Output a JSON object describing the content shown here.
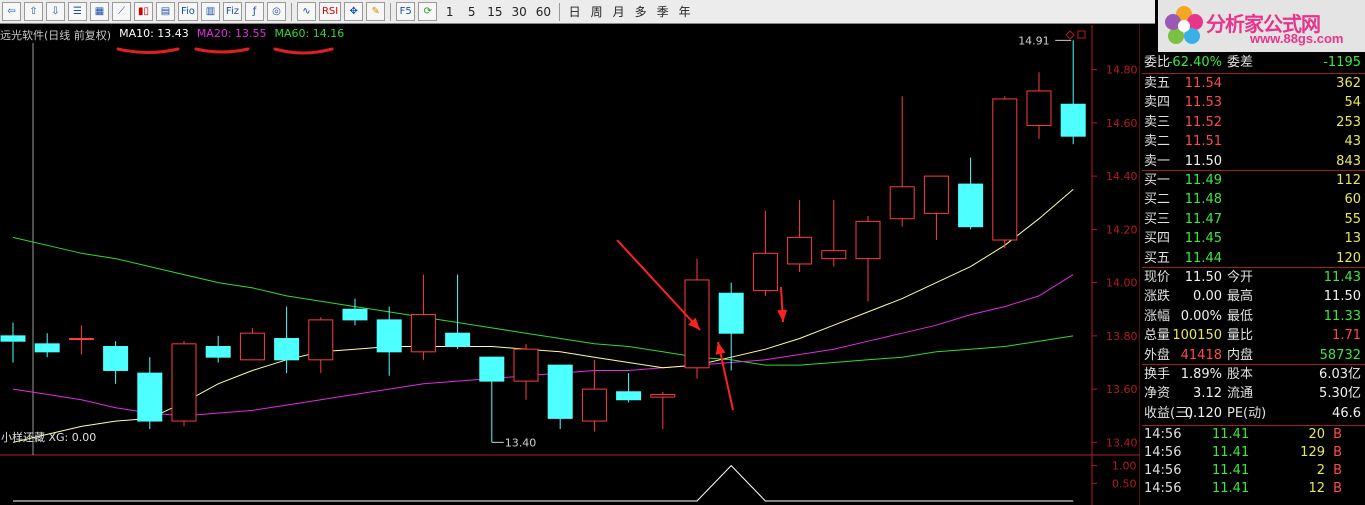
{
  "toolbar": {
    "icons": [
      "back-arrow-icon",
      "up-arrow-icon",
      "down-arrow-icon",
      "list-icon",
      "grid-icon",
      "line-chart-icon",
      "candle-chart-icon",
      "f10-icon",
      "fio-icon",
      "doc-icon",
      "fiz-icon",
      "flow-icon",
      "circle-icon"
    ],
    "indicator_buttons": [
      "RSI"
    ],
    "tool_icons": [
      "wave-icon",
      "move-icon",
      "pen-icon"
    ],
    "f5_label": "F5",
    "refresh_icon": "refresh-icon",
    "minute_periods": [
      "1",
      "5",
      "15",
      "30",
      "60"
    ],
    "periods": [
      "日",
      "周",
      "月",
      "多",
      "季",
      "年"
    ]
  },
  "logo": {
    "text": "分析家公式网",
    "url": "www.88gs.com",
    "icon": "flower-logo-icon"
  },
  "chart": {
    "title": "远光软件(日线 前复权)",
    "ma10_label": "MA10: 13.43",
    "ma20_label": "MA20: 13.55",
    "ma60_label": "MA60: 14.16",
    "high_marker": "14.91",
    "low_marker": "13.40",
    "indicator_label": "小样还藏 XG: 0.00",
    "colors": {
      "up": "#ff3c3c",
      "down": "#4dffff",
      "ma10": "#ffffa0",
      "ma20": "#e22be2",
      "ma60": "#32d832",
      "axis": "#b01e1e",
      "annotation": "#ff2020"
    }
  },
  "chart_data": {
    "type": "candlestick",
    "ylim": [
      13.36,
      14.9
    ],
    "y_ticks": [
      "14.80",
      "14.60",
      "14.40",
      "14.20",
      "14.00",
      "13.80",
      "13.60",
      "13.40"
    ],
    "candles": [
      {
        "o": 13.8,
        "h": 13.85,
        "l": 13.7,
        "c": 13.78
      },
      {
        "o": 13.77,
        "h": 13.81,
        "l": 13.72,
        "c": 13.74
      },
      {
        "o": 13.79,
        "h": 13.84,
        "l": 13.73,
        "c": 13.79
      },
      {
        "o": 13.76,
        "h": 13.78,
        "l": 13.62,
        "c": 13.67
      },
      {
        "o": 13.66,
        "h": 13.72,
        "l": 13.45,
        "c": 13.48
      },
      {
        "o": 13.48,
        "h": 13.78,
        "l": 13.46,
        "c": 13.77
      },
      {
        "o": 13.76,
        "h": 13.8,
        "l": 13.7,
        "c": 13.72
      },
      {
        "o": 13.71,
        "h": 13.83,
        "l": 13.71,
        "c": 13.81
      },
      {
        "o": 13.79,
        "h": 13.91,
        "l": 13.66,
        "c": 13.71
      },
      {
        "o": 13.71,
        "h": 13.87,
        "l": 13.66,
        "c": 13.86
      },
      {
        "o": 13.9,
        "h": 13.94,
        "l": 13.84,
        "c": 13.86
      },
      {
        "o": 13.86,
        "h": 13.91,
        "l": 13.65,
        "c": 13.74
      },
      {
        "o": 13.74,
        "h": 14.03,
        "l": 13.71,
        "c": 13.88
      },
      {
        "o": 13.81,
        "h": 14.03,
        "l": 13.75,
        "c": 13.76
      },
      {
        "o": 13.72,
        "h": 13.72,
        "l": 13.4,
        "c": 13.63
      },
      {
        "o": 13.63,
        "h": 13.77,
        "l": 13.56,
        "c": 13.75
      },
      {
        "o": 13.69,
        "h": 13.69,
        "l": 13.45,
        "c": 13.49
      },
      {
        "o": 13.48,
        "h": 13.71,
        "l": 13.44,
        "c": 13.6
      },
      {
        "o": 13.59,
        "h": 13.66,
        "l": 13.55,
        "c": 13.56
      },
      {
        "o": 13.57,
        "h": 13.59,
        "l": 13.45,
        "c": 13.58
      },
      {
        "o": 13.68,
        "h": 14.09,
        "l": 13.64,
        "c": 14.01
      },
      {
        "o": 13.96,
        "h": 14.0,
        "l": 13.67,
        "c": 13.81
      },
      {
        "o": 13.97,
        "h": 14.27,
        "l": 13.95,
        "c": 14.11
      },
      {
        "o": 14.07,
        "h": 14.31,
        "l": 14.04,
        "c": 14.17
      },
      {
        "o": 14.09,
        "h": 14.31,
        "l": 14.06,
        "c": 14.12
      },
      {
        "o": 14.09,
        "h": 14.25,
        "l": 13.93,
        "c": 14.23
      },
      {
        "o": 14.24,
        "h": 14.7,
        "l": 14.21,
        "c": 14.36
      },
      {
        "o": 14.26,
        "h": 14.4,
        "l": 14.16,
        "c": 14.4
      },
      {
        "o": 14.37,
        "h": 14.47,
        "l": 14.2,
        "c": 14.21
      },
      {
        "o": 14.16,
        "h": 14.7,
        "l": 14.13,
        "c": 14.69
      },
      {
        "o": 14.59,
        "h": 14.79,
        "l": 14.54,
        "c": 14.72
      },
      {
        "o": 14.67,
        "h": 14.91,
        "l": 14.52,
        "c": 14.55
      }
    ],
    "ma10": [
      13.4,
      13.43,
      13.46,
      13.48,
      13.49,
      13.55,
      13.62,
      13.67,
      13.71,
      13.74,
      13.75,
      13.76,
      13.76,
      13.76,
      13.76,
      13.75,
      13.74,
      13.72,
      13.7,
      13.68,
      13.69,
      13.72,
      13.75,
      13.79,
      13.84,
      13.89,
      13.94,
      14.0,
      14.06,
      14.14,
      14.24,
      14.35
    ],
    "ma20": [
      13.6,
      13.58,
      13.56,
      13.53,
      13.51,
      13.5,
      13.51,
      13.52,
      13.54,
      13.56,
      13.58,
      13.6,
      13.62,
      13.63,
      13.64,
      13.65,
      13.66,
      13.67,
      13.67,
      13.68,
      13.69,
      13.7,
      13.71,
      13.73,
      13.75,
      13.78,
      13.81,
      13.84,
      13.88,
      13.91,
      13.95,
      14.03
    ],
    "ma60": [
      14.17,
      14.14,
      14.11,
      14.09,
      14.06,
      14.03,
      14.0,
      13.98,
      13.95,
      13.93,
      13.91,
      13.89,
      13.87,
      13.85,
      13.83,
      13.81,
      13.79,
      13.77,
      13.76,
      13.74,
      13.72,
      13.71,
      13.69,
      13.69,
      13.7,
      13.71,
      13.72,
      13.74,
      13.75,
      13.76,
      13.78,
      13.8
    ],
    "ind_ylim": [
      0,
      1.3
    ],
    "ind_ticks": [
      "1.00",
      "0.50"
    ],
    "ind_values": [
      0,
      0,
      0,
      0,
      0,
      0,
      0,
      0,
      0,
      0,
      0,
      0,
      0,
      0,
      0,
      0,
      0,
      0,
      0,
      0,
      0,
      1,
      0,
      0,
      0,
      0,
      0,
      0,
      0,
      0,
      0,
      0
    ]
  },
  "quote": {
    "wb_label": "委比",
    "wb_value": "-62.40%",
    "wc_label": "委差",
    "wc_value": "-1195",
    "asks": [
      {
        "label": "卖五",
        "price": "11.54",
        "vol": "362"
      },
      {
        "label": "卖四",
        "price": "11.53",
        "vol": "54"
      },
      {
        "label": "卖三",
        "price": "11.52",
        "vol": "253"
      },
      {
        "label": "卖二",
        "price": "11.51",
        "vol": "43"
      },
      {
        "label": "卖一",
        "price": "11.50",
        "vol": "843"
      }
    ],
    "bids": [
      {
        "label": "买一",
        "price": "11.49",
        "vol": "112"
      },
      {
        "label": "买二",
        "price": "11.48",
        "vol": "60"
      },
      {
        "label": "买三",
        "price": "11.47",
        "vol": "55"
      },
      {
        "label": "买四",
        "price": "11.45",
        "vol": "13"
      },
      {
        "label": "买五",
        "price": "11.44",
        "vol": "120"
      }
    ],
    "stats": [
      {
        "l1": "现价",
        "v1": "11.50",
        "c1": "white",
        "l2": "今开",
        "v2": "11.43",
        "c2": "green"
      },
      {
        "l1": "涨跌",
        "v1": "0.00",
        "c1": "white",
        "l2": "最高",
        "v2": "11.50",
        "c2": "white"
      },
      {
        "l1": "涨幅",
        "v1": "0.00%",
        "c1": "white",
        "l2": "最低",
        "v2": "11.33",
        "c2": "green"
      },
      {
        "l1": "总量",
        "v1": "100150",
        "c1": "yellow",
        "l2": "量比",
        "v2": "1.71",
        "c2": "red"
      },
      {
        "l1": "外盘",
        "v1": "41418",
        "c1": "red",
        "l2": "内盘",
        "v2": "58732",
        "c2": "green"
      }
    ],
    "stats2": [
      {
        "l1": "换手",
        "v1": "1.89%",
        "c1": "white",
        "l2": "股本",
        "v2": "6.03亿",
        "c2": "white"
      },
      {
        "l1": "净资",
        "v1": "3.12",
        "c1": "white",
        "l2": "流通",
        "v2": "5.30亿",
        "c2": "white"
      },
      {
        "l1": "收益(三)",
        "v1": "0.120",
        "c1": "white",
        "l2": "PE(动)",
        "v2": "46.6",
        "c2": "white"
      }
    ],
    "ticks": [
      {
        "time": "14:56",
        "price": "11.41",
        "vol": "20",
        "side": "B"
      },
      {
        "time": "14:56",
        "price": "11.41",
        "vol": "129",
        "side": "B"
      },
      {
        "time": "14:56",
        "price": "11.41",
        "vol": "2",
        "side": "B"
      },
      {
        "time": "14:56",
        "price": "11.41",
        "vol": "12",
        "side": "B"
      }
    ]
  }
}
